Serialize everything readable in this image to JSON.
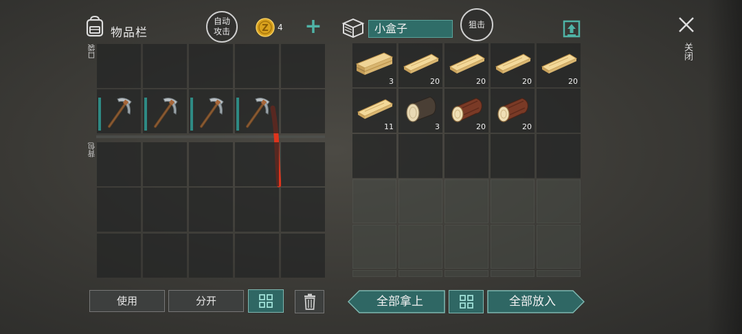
{
  "header": {
    "inventory_title": "物品栏",
    "auto_attack": "自动攻击",
    "coin_count": "4",
    "container_name": "小盒子",
    "snipe": "狙击",
    "close_label": "关闭"
  },
  "sections": {
    "pocket": "口袋",
    "backpack": "背包"
  },
  "pocket_row": [
    {
      "item": "pickaxe",
      "durability": 0.85
    },
    {
      "item": "pickaxe",
      "durability": 0.85
    },
    {
      "item": "pickaxe",
      "durability": 0.85
    },
    {
      "item": "pickaxe",
      "durability": 0.85
    },
    {
      "item": ""
    }
  ],
  "container_items": [
    {
      "item": "wooden-plank-bundle",
      "qty": "3"
    },
    {
      "item": "wooden-plank",
      "qty": "20"
    },
    {
      "item": "wooden-plank",
      "qty": "20"
    },
    {
      "item": "wooden-plank",
      "qty": "20"
    },
    {
      "item": "wooden-plank",
      "qty": "20"
    },
    {
      "item": "wooden-plank",
      "qty": "11"
    },
    {
      "item": "pine-log",
      "qty": "3"
    },
    {
      "item": "oak-log",
      "qty": "20"
    },
    {
      "item": "oak-log",
      "qty": "20"
    }
  ],
  "buttons": {
    "use": "使用",
    "split": "分开",
    "take_all": "全部拿上",
    "put_all": "全部放入"
  },
  "colors": {
    "accent_teal": "#2f6d68",
    "annotation_red": "#e0341c",
    "coin_gold": "#d9a21d"
  }
}
